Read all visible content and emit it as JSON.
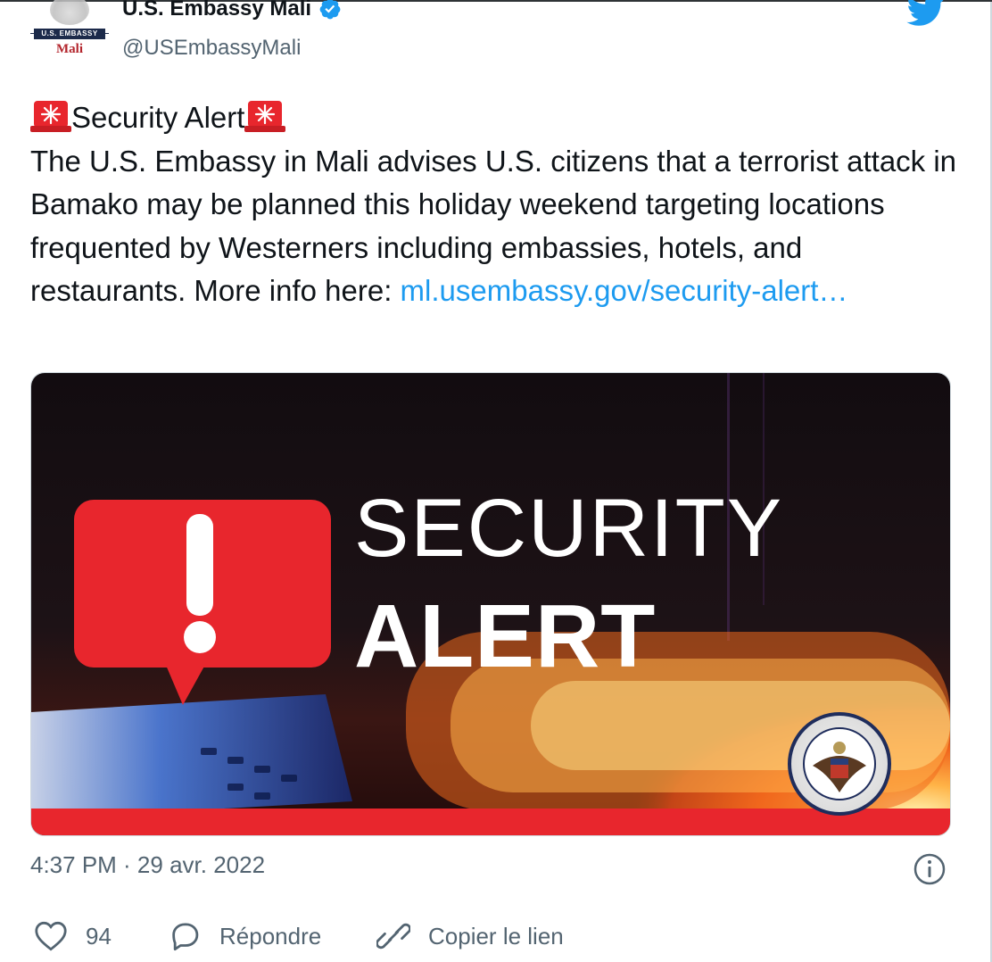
{
  "account": {
    "display_name": "U.S. Embassy Mali",
    "handle": "@USEmbassyMali",
    "avatar_banner": "U.S. EMBASSY",
    "avatar_country": "Mali",
    "verified_icon": "verified-badge-icon",
    "platform_icon": "twitter-bird-icon"
  },
  "tweet": {
    "headline": "Security Alert",
    "body": "The U.S. Embassy in Mali advises U.S. citizens that a terrorist attack in Bamako may be planned this holiday weekend targeting locations frequented by Westerners including embassies, hotels, and restaurants. More info here:",
    "link_text": "ml.usembassy.gov/security-alert…",
    "emoji_icon": "rotating-light-icon"
  },
  "media": {
    "line1": "SECURITY",
    "line2": "ALERT",
    "seal_text": "DEPARTMENT OF STATE · UNITED STATES OF AMERICA",
    "alert_icon": "exclamation-bubble-icon"
  },
  "meta": {
    "timestamp": "4:37 PM · 29 avr. 2022",
    "info_icon": "info-icon"
  },
  "actions": {
    "like_count": "94",
    "reply_label": "Répondre",
    "copy_label": "Copier le lien"
  },
  "colors": {
    "link": "#1d9bf0",
    "secondary_text": "#536471",
    "alert_red": "#e8262d"
  }
}
